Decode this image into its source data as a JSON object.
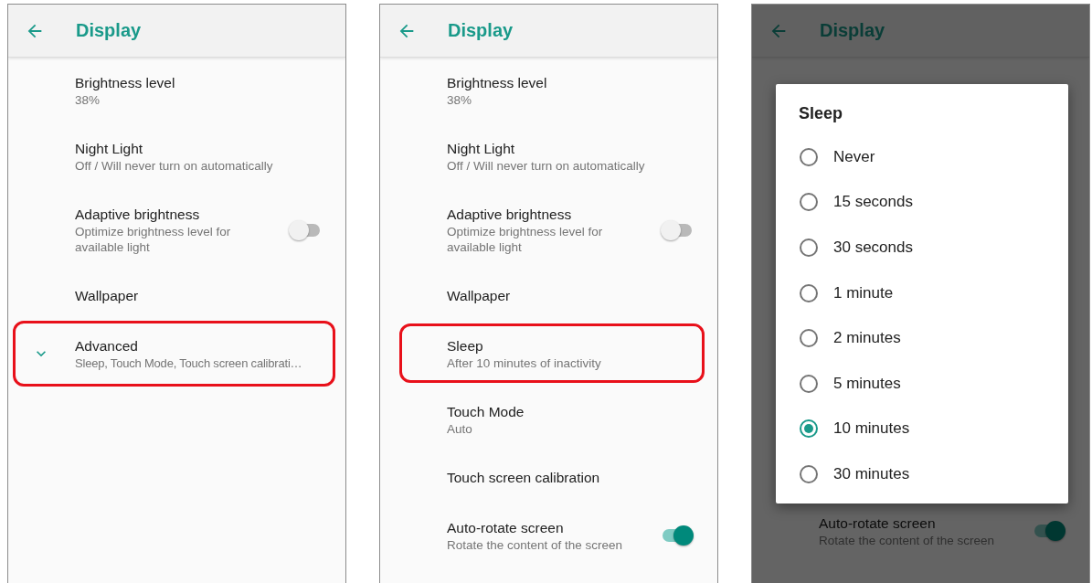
{
  "panels": [
    {
      "header": {
        "title": "Display"
      },
      "items": [
        {
          "kind": "plain",
          "title": "Brightness level",
          "summary": "38%",
          "highlighted": false
        },
        {
          "kind": "plain",
          "title": "Night Light",
          "summary": "Off / Will never turn on automatically",
          "highlighted": false
        },
        {
          "kind": "switch",
          "title": "Adaptive brightness",
          "summary": "Optimize brightness level for available light",
          "on": false,
          "highlighted": false
        },
        {
          "kind": "plain",
          "title": "Wallpaper",
          "highlighted": false
        },
        {
          "kind": "expand",
          "title": "Advanced",
          "summary": "Sleep, Touch Mode, Touch screen calibrati…",
          "highlighted": true
        }
      ]
    },
    {
      "header": {
        "title": "Display"
      },
      "items": [
        {
          "kind": "plain",
          "title": "Brightness level",
          "summary": "38%",
          "highlighted": false
        },
        {
          "kind": "plain",
          "title": "Night Light",
          "summary": "Off / Will never turn on automatically",
          "highlighted": false
        },
        {
          "kind": "switch",
          "title": "Adaptive brightness",
          "summary": "Optimize brightness level for available light",
          "on": false,
          "highlighted": false
        },
        {
          "kind": "plain",
          "title": "Wallpaper",
          "highlighted": false
        },
        {
          "kind": "plain",
          "title": "Sleep",
          "summary": "After 10 minutes of inactivity",
          "highlighted": true
        },
        {
          "kind": "plain",
          "title": "Touch Mode",
          "summary": "Auto",
          "highlighted": false
        },
        {
          "kind": "plain",
          "title": "Touch screen calibration",
          "highlighted": false
        },
        {
          "kind": "switch",
          "title": "Auto-rotate screen",
          "summary": "Rotate the content of the screen",
          "on": true,
          "highlighted": false
        }
      ]
    },
    {
      "header": {
        "title": "Display"
      },
      "items": [
        {
          "kind": "switch",
          "title": "Auto-rotate screen",
          "summary": "Rotate the content of the screen",
          "on": true,
          "highlighted": false
        }
      ],
      "dialog": {
        "title": "Sleep",
        "options": [
          {
            "label": "Never",
            "selected": false
          },
          {
            "label": "15 seconds",
            "selected": false
          },
          {
            "label": "30 seconds",
            "selected": false
          },
          {
            "label": "1 minute",
            "selected": false
          },
          {
            "label": "2 minutes",
            "selected": false
          },
          {
            "label": "5 minutes",
            "selected": false
          },
          {
            "label": "10 minutes",
            "selected": true
          },
          {
            "label": "30 minutes",
            "selected": false
          }
        ]
      }
    }
  ]
}
